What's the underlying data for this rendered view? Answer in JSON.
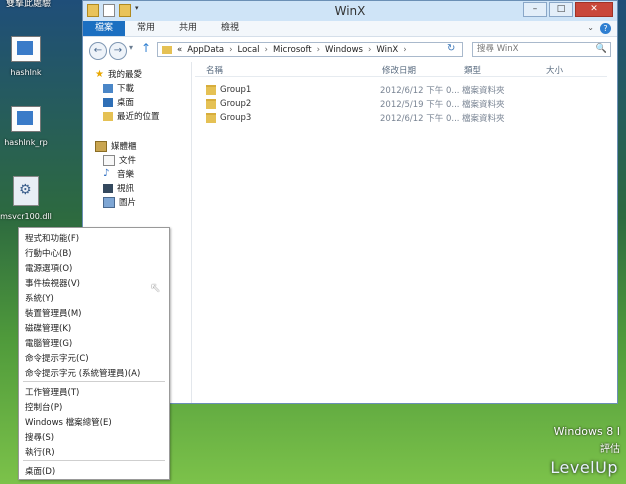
{
  "desktop": {
    "top_label": "雙擊此處驗",
    "icons": [
      {
        "label": "hashlnk",
        "icon": "file-icon"
      },
      {
        "label": "hashlnk_rp",
        "icon": "file-icon"
      },
      {
        "label": "msvcr100.dll",
        "icon": "dll-gear-icon"
      }
    ]
  },
  "window": {
    "title": "WinX",
    "controls": {
      "minimize": "–",
      "maximize": "□",
      "close": "✕"
    },
    "ribbon_tabs": [
      "檔案",
      "常用",
      "共用",
      "檢視"
    ],
    "ribbon_expand": "⌄",
    "help": "?",
    "back": "←",
    "forward": "→",
    "up": "↑",
    "address": {
      "prefix": "«",
      "segments": [
        "AppData",
        "Local",
        "Microsoft",
        "Windows",
        "WinX"
      ],
      "separator": "›"
    },
    "refresh": "↻",
    "search_placeholder": "搜尋 WinX",
    "search_icon": "🔍",
    "nav": {
      "favorites_title": "我的最愛",
      "favorites": [
        "下載",
        "桌面",
        "最近的位置"
      ],
      "libraries_title": "媒體櫃",
      "libraries": [
        "文件",
        "音樂",
        "視訊",
        "圖片"
      ]
    },
    "columns": [
      "名稱",
      "修改日期",
      "類型",
      "大小"
    ],
    "files": [
      {
        "name": "Group1",
        "date": "2012/6/12 下午 0...",
        "type": "檔案資料夾"
      },
      {
        "name": "Group2",
        "date": "2012/5/19 下午 0...",
        "type": "檔案資料夾"
      },
      {
        "name": "Group3",
        "date": "2012/6/12 下午 0...",
        "type": "檔案資料夾"
      }
    ]
  },
  "winx_menu": {
    "items_group1": [
      "程式和功能(F)",
      "行動中心(B)",
      "電源選項(O)",
      "事件檢視器(V)",
      "系統(Y)",
      "裝置管理員(M)",
      "磁碟管理(K)",
      "電腦管理(G)",
      "命令提示字元(C)",
      "命令提示字元 (系統管理員)(A)"
    ],
    "items_group2": [
      "工作管理員(T)",
      "控制台(P)",
      "Windows 檔案總管(E)",
      "搜尋(S)",
      "執行(R)"
    ],
    "items_group3": [
      "桌面(D)"
    ]
  },
  "watermark": {
    "os": "Windows 8 I",
    "eval": "評估",
    "logo": "LevelUp"
  }
}
